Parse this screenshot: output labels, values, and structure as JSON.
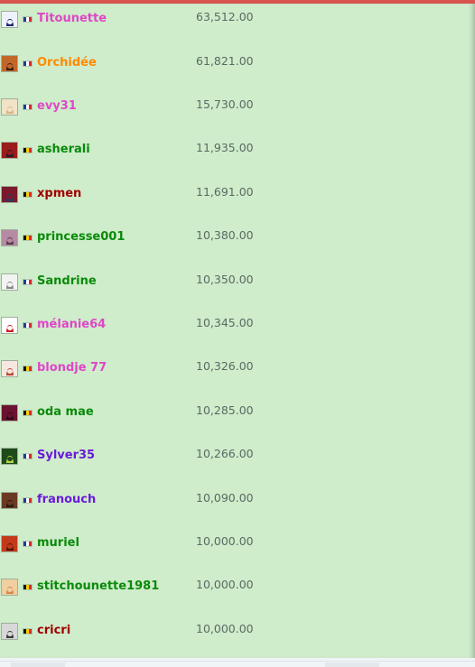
{
  "leaderboard": {
    "rows": [
      {
        "name": "Titounette",
        "score": "63,512.00",
        "name_color": "#e046c8",
        "flag": "fr",
        "avatar": "cat-icon",
        "avatar_colors": [
          "#eef2ff",
          "#1b2a6b"
        ]
      },
      {
        "name": "Orchidée",
        "score": "61,821.00",
        "name_color": "#ff8a00",
        "flag": "fr",
        "avatar": "photo-avatar",
        "avatar_colors": [
          "#c2662a",
          "#3b1f16"
        ]
      },
      {
        "name": "evy31",
        "score": "15,730.00",
        "name_color": "#e046c8",
        "flag": "fr",
        "avatar": "photo-avatar",
        "avatar_colors": [
          "#f1e3c6",
          "#d9b48a"
        ]
      },
      {
        "name": "asherali",
        "score": "11,935.00",
        "name_color": "#0a8a0a",
        "flag": "be",
        "avatar": "photo-avatar",
        "avatar_colors": [
          "#9b1b1b",
          "#1f1f2a"
        ]
      },
      {
        "name": "xpmen",
        "score": "11,691.00",
        "name_color": "#a00000",
        "flag": "be",
        "avatar": "photo-avatar",
        "avatar_colors": [
          "#7a1a2a",
          "#2c3a6a"
        ]
      },
      {
        "name": "princesse001",
        "score": "10,380.00",
        "name_color": "#0a8a0a",
        "flag": "be",
        "avatar": "photo-avatar",
        "avatar_colors": [
          "#b58aa2",
          "#5a3b4a"
        ]
      },
      {
        "name": "Sandrine",
        "score": "10,350.00",
        "name_color": "#0a8a0a",
        "flag": "fr",
        "avatar": "photo-avatar",
        "avatar_colors": [
          "#f3f3f3",
          "#8a8a8a"
        ]
      },
      {
        "name": "mélanie64",
        "score": "10,345.00",
        "name_color": "#e046c8",
        "flag": "fr",
        "avatar": "photo-avatar",
        "avatar_colors": [
          "#ffffff",
          "#c81e1e"
        ]
      },
      {
        "name": "blondje 77",
        "score": "10,326.00",
        "name_color": "#e046c8",
        "flag": "be",
        "avatar": "photo-avatar",
        "avatar_colors": [
          "#f6e7e1",
          "#b84a32"
        ]
      },
      {
        "name": "oda mae",
        "score": "10,285.00",
        "name_color": "#0a8a0a",
        "flag": "be",
        "avatar": "photo-avatar",
        "avatar_colors": [
          "#6a1230",
          "#2a0a18"
        ]
      },
      {
        "name": "Sylver35",
        "score": "10,266.00",
        "name_color": "#6a1ad8",
        "flag": "fr",
        "avatar": "photo-avatar",
        "avatar_colors": [
          "#1f4a1a",
          "#b7d44a"
        ]
      },
      {
        "name": "franouch",
        "score": "10,090.00",
        "name_color": "#6a1ad8",
        "flag": "fr",
        "avatar": "photo-avatar",
        "avatar_colors": [
          "#6a3a22",
          "#2a1a12"
        ]
      },
      {
        "name": "muriel",
        "score": "10,000.00",
        "name_color": "#0a8a0a",
        "flag": "fr",
        "avatar": "photo-avatar",
        "avatar_colors": [
          "#c23a1a",
          "#5a120a"
        ]
      },
      {
        "name": "stitchounette1981",
        "score": "10,000.00",
        "name_color": "#0a8a0a",
        "flag": "be",
        "avatar": "photo-avatar",
        "avatar_colors": [
          "#f0cfa0",
          "#d48a4a"
        ]
      },
      {
        "name": "cricri",
        "score": "10,000.00",
        "name_color": "#a00000",
        "flag": "be",
        "avatar": "husky-photo",
        "avatar_colors": [
          "#d8d8d8",
          "#3a3a3a"
        ]
      }
    ]
  },
  "flags": {
    "fr": [
      "#1f3c96",
      "#ffffff",
      "#e0242c"
    ],
    "be": [
      "#111111",
      "#f5d400",
      "#e0242c"
    ]
  }
}
